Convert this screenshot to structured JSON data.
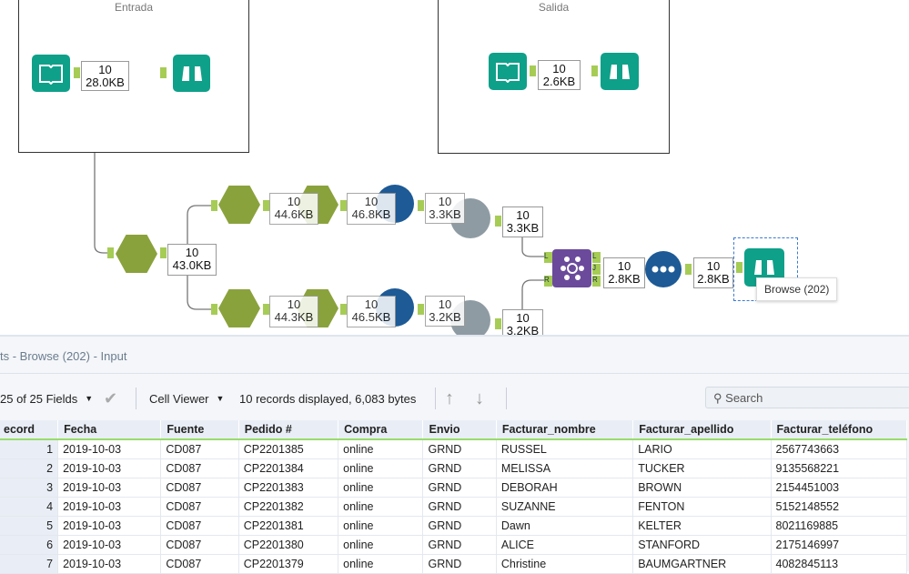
{
  "containers": {
    "input": "Entrada",
    "output": "Salida"
  },
  "badges": {
    "entrada": [
      "10",
      "28.0KB"
    ],
    "salida": [
      "10",
      "2.6KB"
    ],
    "filter": [
      "10",
      "43.0KB"
    ],
    "top1": [
      "10",
      "44.6KB"
    ],
    "top2": [
      "10",
      "46.8KB"
    ],
    "top3": [
      "10",
      "3.3KB"
    ],
    "top4": [
      "10",
      "3.3KB"
    ],
    "bot1": [
      "10",
      "44.3KB"
    ],
    "bot2": [
      "10",
      "46.5KB"
    ],
    "bot3": [
      "10",
      "3.2KB"
    ],
    "bot4": [
      "10",
      "3.2KB"
    ],
    "join": [
      "10",
      "2.8KB"
    ],
    "union": [
      "10",
      "2.8KB"
    ]
  },
  "anchors": {
    "left": "L",
    "right": "R",
    "join": "J"
  },
  "tooltip": "Browse (202)",
  "results": {
    "title": "ts - Browse (202) - Input",
    "fields": "25 of 25 Fields",
    "viewer": "Cell Viewer",
    "summary": "10 records displayed, 6,083 bytes",
    "search_placeholder": "Search",
    "columns": [
      "ecord",
      "Fecha",
      "Fuente",
      "Pedido #",
      "Compra",
      "Envio",
      "Facturar_nombre",
      "Facturar_apellido",
      "Facturar_teléfono"
    ],
    "rows": [
      [
        "1",
        "2019-10-03",
        "CD087",
        "CP2201385",
        "online",
        "GRND",
        "RUSSEL",
        "LARIO",
        "2567743663"
      ],
      [
        "2",
        "2019-10-03",
        "CD087",
        "CP2201384",
        "online",
        "GRND",
        "MELISSA",
        "TUCKER",
        "9135568221"
      ],
      [
        "3",
        "2019-10-03",
        "CD087",
        "CP2201383",
        "online",
        "GRND",
        "DEBORAH",
        "BROWN",
        "2154451003"
      ],
      [
        "4",
        "2019-10-03",
        "CD087",
        "CP2201382",
        "online",
        "GRND",
        "SUZANNE",
        "FENTON",
        "5152148552"
      ],
      [
        "5",
        "2019-10-03",
        "CD087",
        "CP2201381",
        "online",
        "GRND",
        "Dawn",
        "KELTER",
        "8021169885"
      ],
      [
        "6",
        "2019-10-03",
        "CD087",
        "CP2201380",
        "online",
        "GRND",
        "ALICE",
        "STANFORD",
        "2175146997"
      ],
      [
        "7",
        "2019-10-03",
        "CD087",
        "CP2201379",
        "online",
        "GRND",
        "Christine",
        "BAUMGARTNER",
        "4082845113"
      ]
    ]
  }
}
